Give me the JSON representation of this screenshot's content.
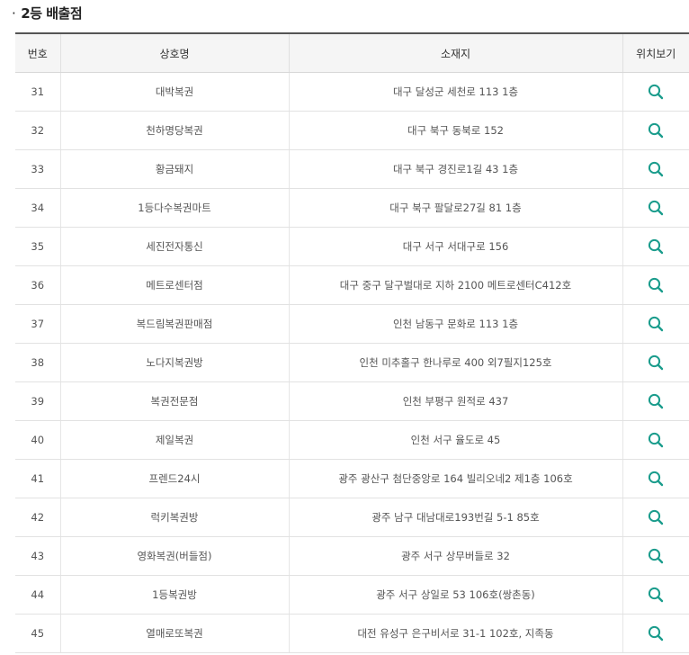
{
  "title": "2등 배출점",
  "title_bullet": "·",
  "columns": {
    "num": "번호",
    "name": "상호명",
    "addr": "소재지",
    "loc": "위치보기"
  },
  "accent_color": "#1a9c8c",
  "rows": [
    {
      "num": "31",
      "name": "대박복권",
      "addr": "대구 달성군 세천로 113 1층"
    },
    {
      "num": "32",
      "name": "천하명당복권",
      "addr": "대구 북구 동북로 152"
    },
    {
      "num": "33",
      "name": "황금돼지",
      "addr": "대구 북구 경진로1길 43 1층"
    },
    {
      "num": "34",
      "name": "1등다수복권마트",
      "addr": "대구 북구 팔달로27길 81 1층"
    },
    {
      "num": "35",
      "name": "세진전자통신",
      "addr": "대구 서구 서대구로 156"
    },
    {
      "num": "36",
      "name": "메트로센터점",
      "addr": "대구 중구 달구벌대로 지하 2100 메트로센터C412호"
    },
    {
      "num": "37",
      "name": "복드림복권판매점",
      "addr": "인천 남동구 문화로 113 1층"
    },
    {
      "num": "38",
      "name": "노다지복권방",
      "addr": "인천 미추홀구 한나루로 400 외7필지125호"
    },
    {
      "num": "39",
      "name": "복권전문점",
      "addr": "인천 부평구 원적로 437"
    },
    {
      "num": "40",
      "name": "제일복권",
      "addr": "인천 서구 율도로 45"
    },
    {
      "num": "41",
      "name": "프렌드24시",
      "addr": "광주 광산구 첨단중앙로 164 빌리오네2 제1층 106호"
    },
    {
      "num": "42",
      "name": "럭키복권방",
      "addr": "광주 남구 대남대로193번길 5-1 85호"
    },
    {
      "num": "43",
      "name": "영화복권(버들점)",
      "addr": "광주 서구 상무버들로 32"
    },
    {
      "num": "44",
      "name": "1등복권방",
      "addr": "광주 서구 상일로 53 106호(쌍촌동)"
    },
    {
      "num": "45",
      "name": "열매로또복권",
      "addr": "대전 유성구 은구비서로 31-1 102호, 지족동"
    }
  ]
}
